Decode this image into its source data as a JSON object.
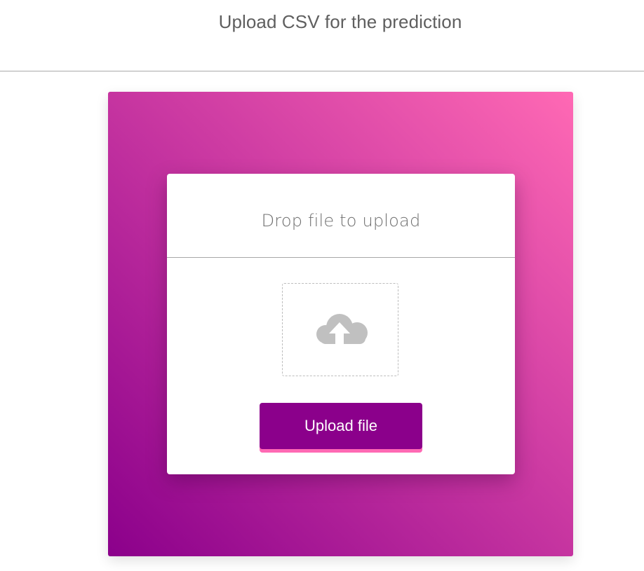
{
  "page": {
    "title": "Upload CSV for the prediction"
  },
  "upload_card": {
    "heading": "Drop file to upload",
    "drop_zone_icon": "cloud-upload-icon",
    "button_label": "Upload file"
  },
  "colors": {
    "gradient_start": "#8b008b",
    "gradient_end": "#ff69b4",
    "button": "#8b008b",
    "button_underline": "#ff69b4",
    "icon": "#c0c0c0"
  }
}
